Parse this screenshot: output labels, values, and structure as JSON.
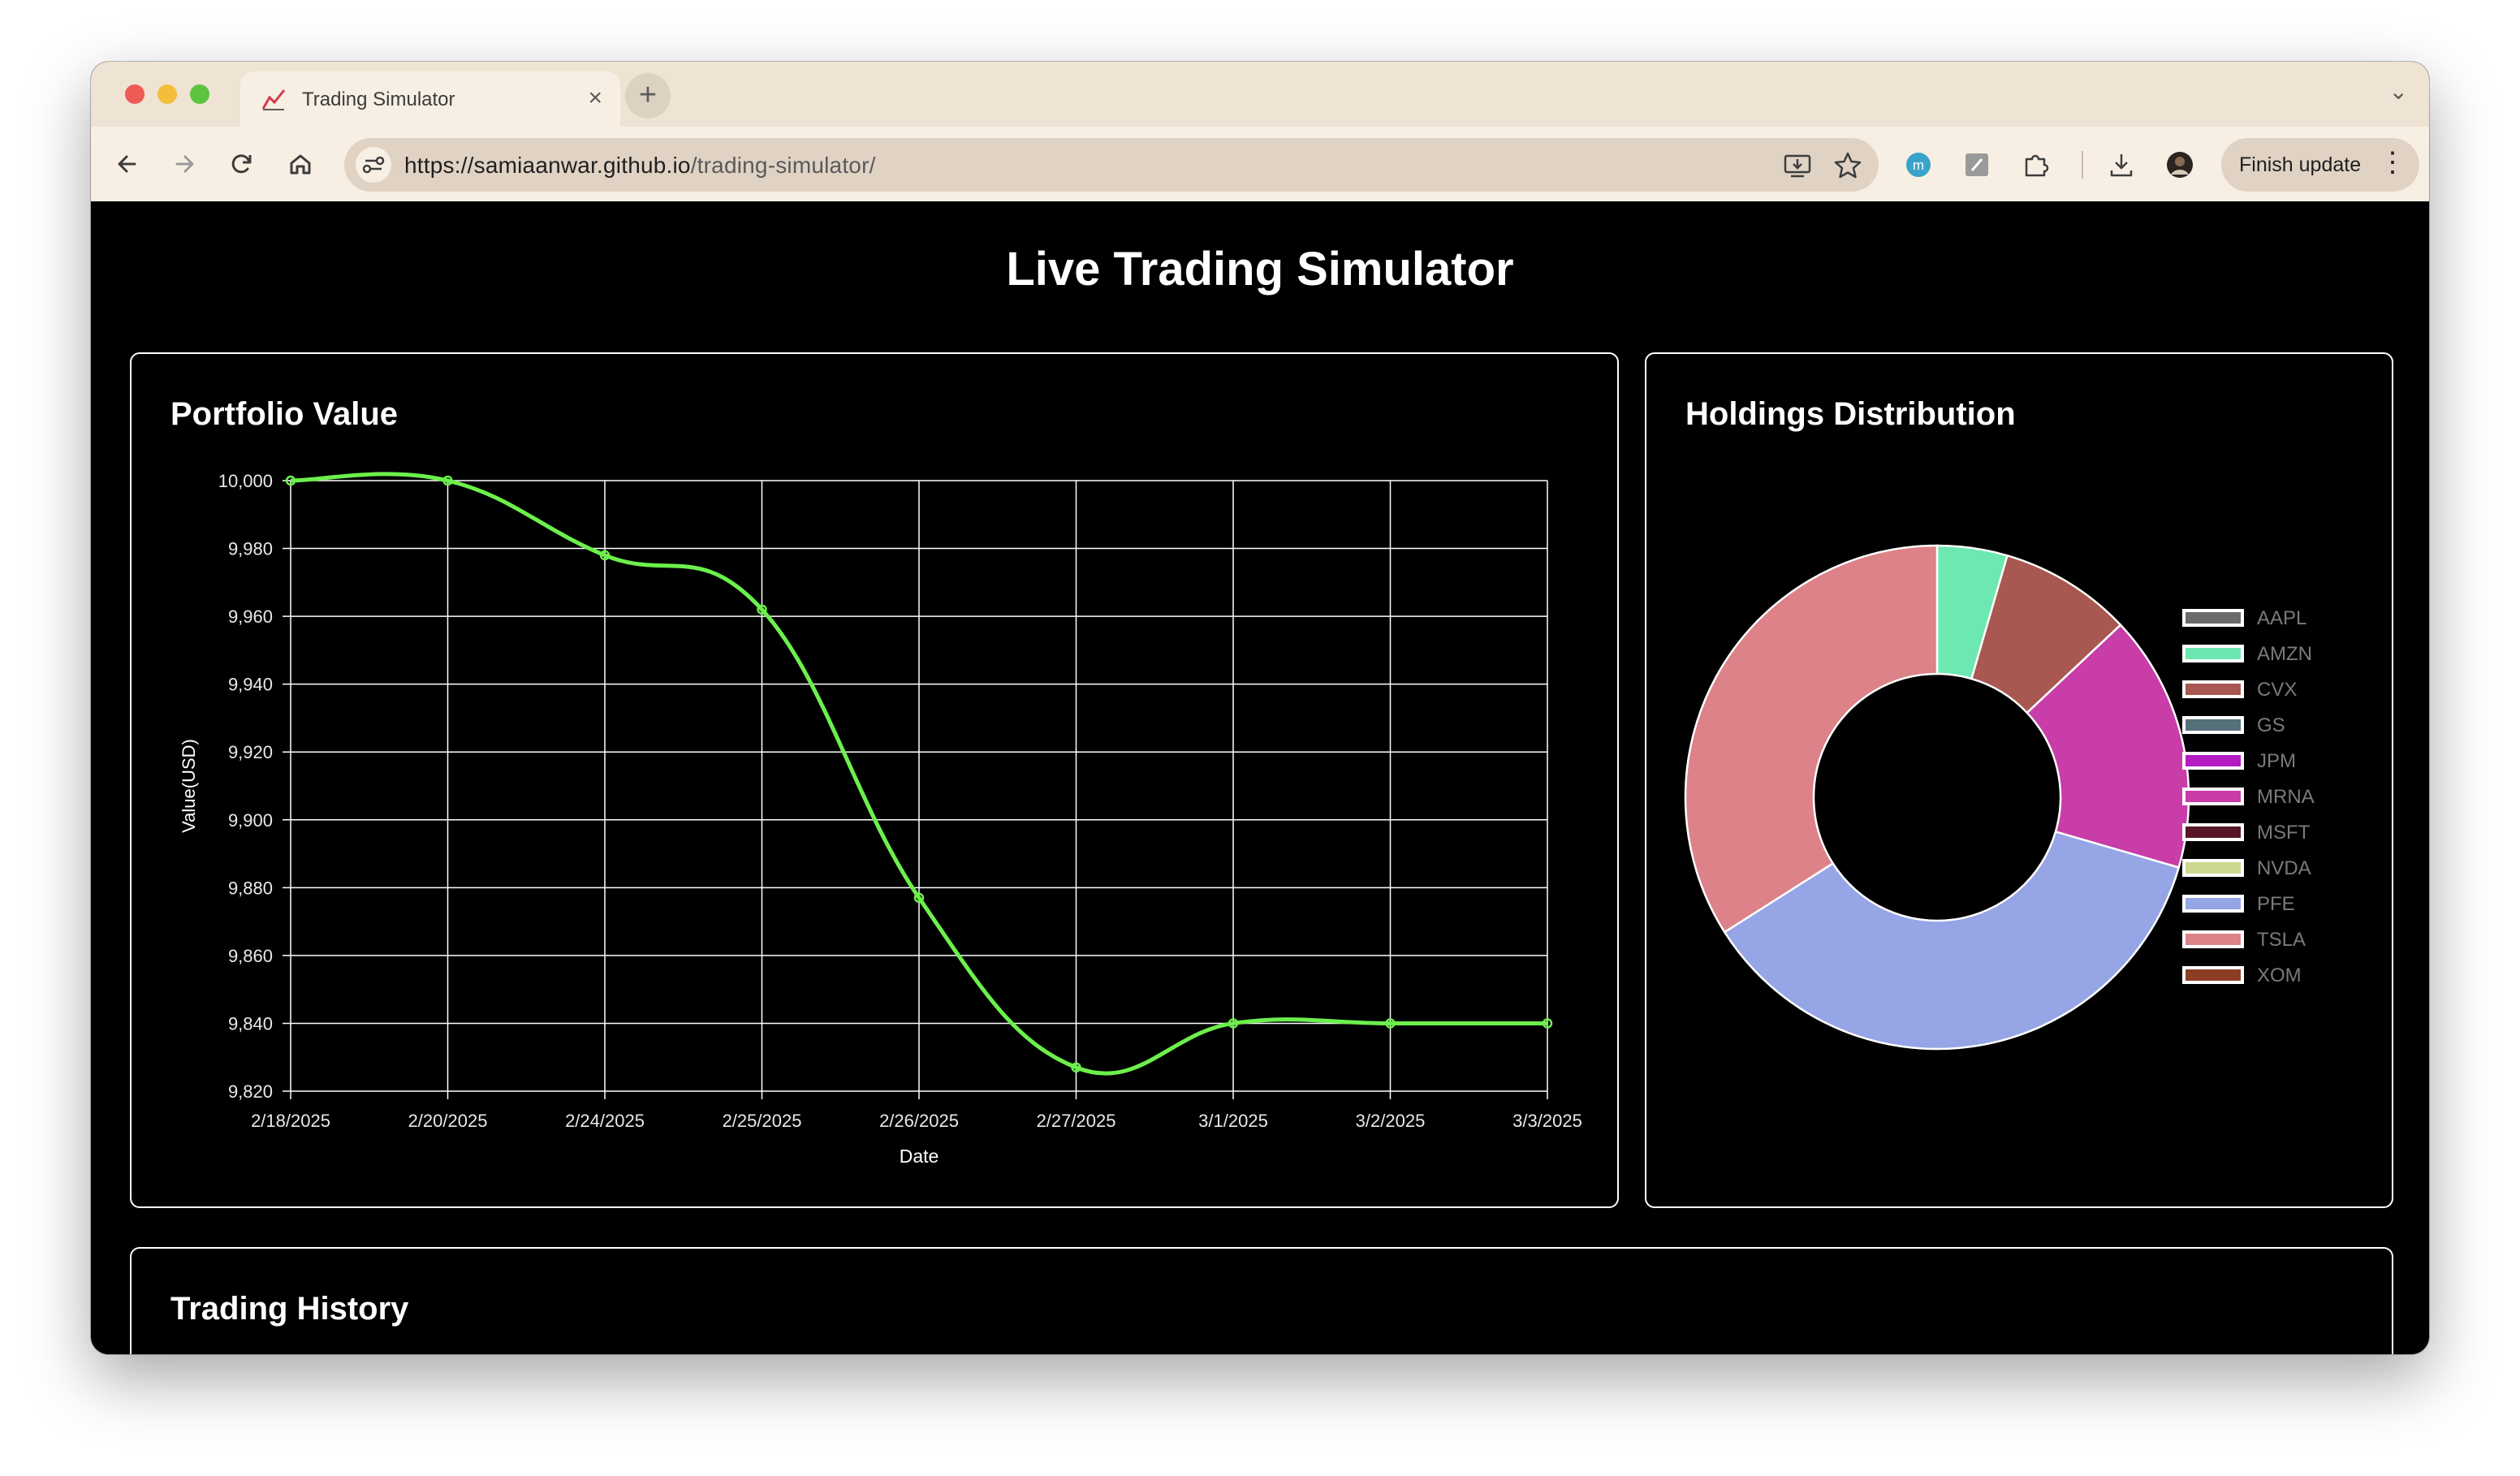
{
  "browser": {
    "tab_title": "Trading Simulator",
    "tab_close": "×",
    "new_tab": "+",
    "tab_menu": "⌄",
    "url_host": "https://samiaanwar.github.io",
    "url_path": "/trading-simulator/",
    "finish_update_label": "Finish update",
    "menu_glyph": "⋮",
    "icons": [
      "back-icon",
      "forward-icon",
      "reload-icon",
      "home-icon",
      "site-settings-icon",
      "install-icon",
      "star-icon",
      "extension-m-icon",
      "extension-note-icon",
      "extensions-puzzle-icon",
      "download-icon",
      "profile-avatar"
    ]
  },
  "page": {
    "title": "Live Trading Simulator",
    "portfolio_card_title": "Portfolio Value",
    "holdings_card_title": "Holdings Distribution",
    "history_card_title": "Trading History"
  },
  "chart_data": [
    {
      "type": "line",
      "title": "Portfolio Value",
      "xlabel": "Date",
      "ylabel": "Value(USD)",
      "x": [
        "2/18/2025",
        "2/20/2025",
        "2/24/2025",
        "2/25/2025",
        "2/26/2025",
        "2/27/2025",
        "3/1/2025",
        "3/2/2025",
        "3/3/2025"
      ],
      "series": [
        {
          "values": [
            10000,
            10000,
            9978,
            9962,
            9877,
            9827,
            9840,
            9840,
            9840
          ],
          "color": "#6cf04c"
        }
      ],
      "ylim": [
        9820,
        10000
      ],
      "yticks": [
        10000,
        9980,
        9960,
        9940,
        9920,
        9900,
        9880,
        9860,
        9840,
        9820
      ],
      "ytick_labels": [
        "10,000",
        "9,980",
        "9,960",
        "9,940",
        "9,920",
        "9,900",
        "9,880",
        "9,860",
        "9,840",
        "9,820"
      ],
      "grid": true,
      "curve": "smooth"
    },
    {
      "type": "pie",
      "title": "Holdings Distribution",
      "donut": true,
      "legend_position": "right",
      "labels": [
        "AAPL",
        "AMZN",
        "CVX",
        "GS",
        "JPM",
        "MRNA",
        "MSFT",
        "NVDA",
        "PFE",
        "TSLA",
        "XOM"
      ],
      "values": [
        0,
        4.5,
        8.5,
        0,
        0,
        16.5,
        0,
        0,
        36.5,
        34,
        0
      ],
      "colors": [
        "#6b6b6b",
        "#6de8b0",
        "#a85850",
        "#56707a",
        "#b21cc0",
        "#c83da8",
        "#561628",
        "#cdd88e",
        "#96a5e6",
        "#dc8288",
        "#8c3e24"
      ]
    }
  ]
}
